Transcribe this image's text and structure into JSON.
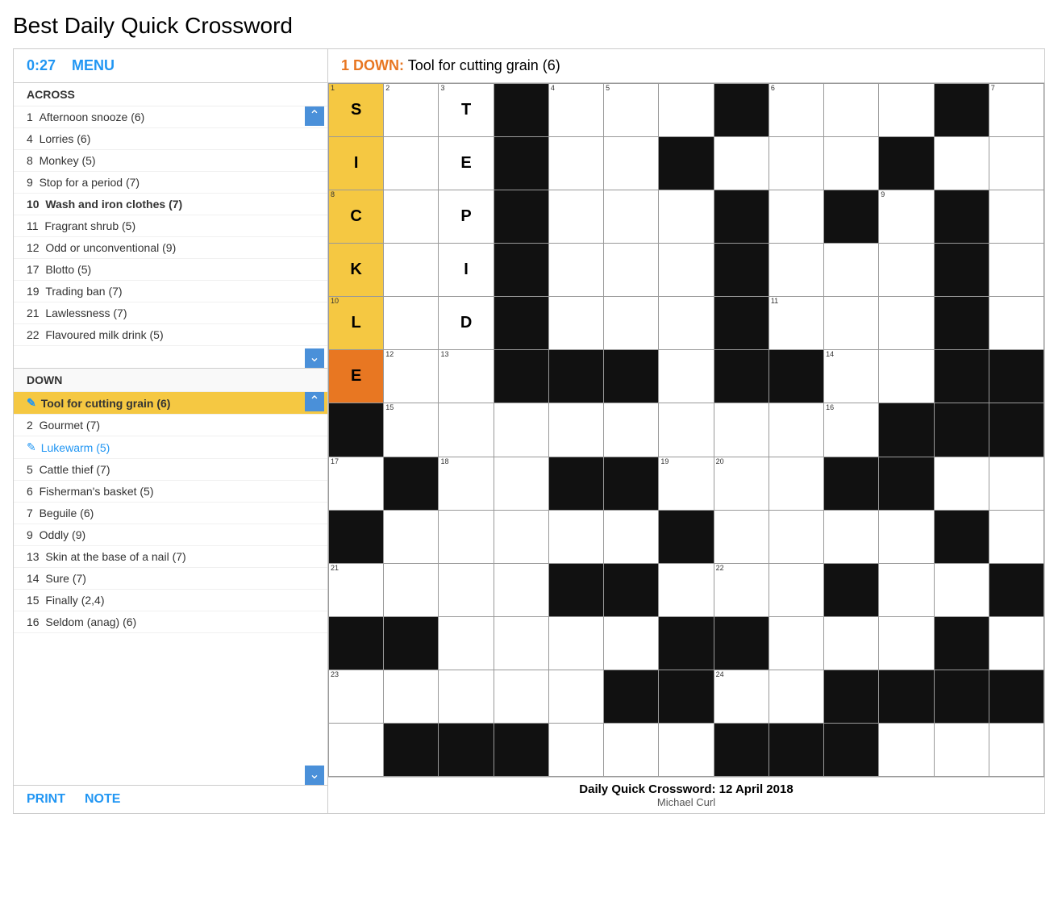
{
  "page": {
    "title": "Best Daily Quick Crossword"
  },
  "header": {
    "timer": "0:27",
    "menu_label": "MENU",
    "active_clue": "1 DOWN: Tool for cutting grain (6)"
  },
  "clues": {
    "across_header": "ACROSS",
    "down_header": "DOWN",
    "across": [
      {
        "number": "1",
        "text": "Afternoon snooze (6)"
      },
      {
        "number": "4",
        "text": "Lorries (6)"
      },
      {
        "number": "8",
        "text": "Monkey (5)"
      },
      {
        "number": "9",
        "text": "Stop for a period (7)"
      },
      {
        "number": "10",
        "text": "Wash and iron clothes (7)"
      },
      {
        "number": "11",
        "text": "Fragrant shrub (5)"
      },
      {
        "number": "12",
        "text": "Odd or unconventional (9)"
      },
      {
        "number": "17",
        "text": "Blotto (5)"
      },
      {
        "number": "19",
        "text": "Trading ban (7)"
      },
      {
        "number": "21",
        "text": "Lawlessness (7)"
      },
      {
        "number": "22",
        "text": "Flavoured milk drink (5)"
      }
    ],
    "down": [
      {
        "number": "1",
        "text": "Tool for cutting grain (6)",
        "active": true
      },
      {
        "number": "2",
        "text": "Gourmet (7)"
      },
      {
        "number": "3",
        "text": "Lukewarm (5)",
        "completed": true
      },
      {
        "number": "5",
        "text": "Cattle thief (7)"
      },
      {
        "number": "6",
        "text": "Fisherman's basket (5)"
      },
      {
        "number": "7",
        "text": "Beguile (6)"
      },
      {
        "number": "9",
        "text": "Oddly (9)"
      },
      {
        "number": "13",
        "text": "Skin at the base of a nail (7)"
      },
      {
        "number": "14",
        "text": "Sure (7)"
      },
      {
        "number": "15",
        "text": "Finally (2,4)"
      },
      {
        "number": "16",
        "text": "Seldom (anag) (6)"
      }
    ]
  },
  "footer": {
    "print_label": "PRINT",
    "note_label": "NOTE",
    "grid_title": "Daily Quick Crossword: 12 April 2018",
    "grid_author": "Michael Curl"
  },
  "grid": {
    "cols": 13,
    "rows": 13
  }
}
